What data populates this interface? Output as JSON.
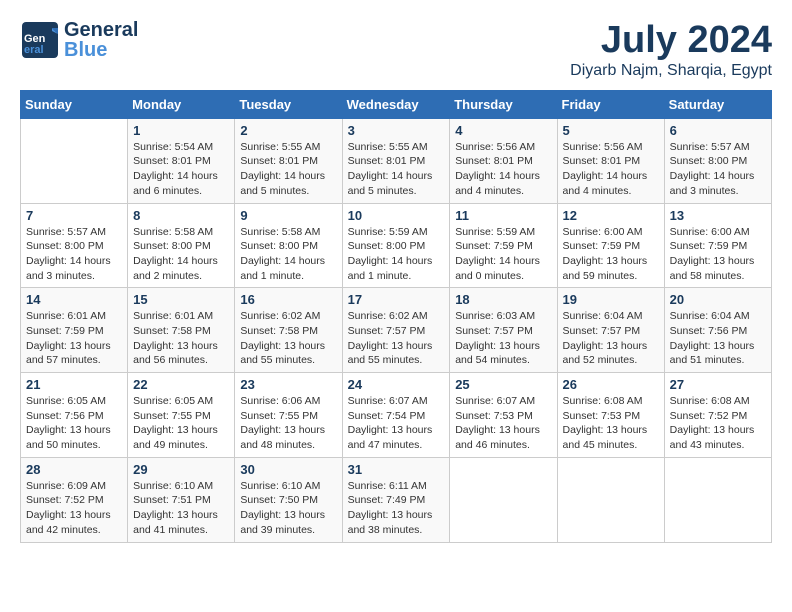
{
  "header": {
    "logo_general": "General",
    "logo_blue": "Blue",
    "month_year": "July 2024",
    "location": "Diyarb Najm, Sharqia, Egypt"
  },
  "calendar": {
    "days_of_week": [
      "Sunday",
      "Monday",
      "Tuesday",
      "Wednesday",
      "Thursday",
      "Friday",
      "Saturday"
    ],
    "weeks": [
      [
        {
          "day": "",
          "info": ""
        },
        {
          "day": "1",
          "info": "Sunrise: 5:54 AM\nSunset: 8:01 PM\nDaylight: 14 hours\nand 6 minutes."
        },
        {
          "day": "2",
          "info": "Sunrise: 5:55 AM\nSunset: 8:01 PM\nDaylight: 14 hours\nand 5 minutes."
        },
        {
          "day": "3",
          "info": "Sunrise: 5:55 AM\nSunset: 8:01 PM\nDaylight: 14 hours\nand 5 minutes."
        },
        {
          "day": "4",
          "info": "Sunrise: 5:56 AM\nSunset: 8:01 PM\nDaylight: 14 hours\nand 4 minutes."
        },
        {
          "day": "5",
          "info": "Sunrise: 5:56 AM\nSunset: 8:01 PM\nDaylight: 14 hours\nand 4 minutes."
        },
        {
          "day": "6",
          "info": "Sunrise: 5:57 AM\nSunset: 8:00 PM\nDaylight: 14 hours\nand 3 minutes."
        }
      ],
      [
        {
          "day": "7",
          "info": "Sunrise: 5:57 AM\nSunset: 8:00 PM\nDaylight: 14 hours\nand 3 minutes."
        },
        {
          "day": "8",
          "info": "Sunrise: 5:58 AM\nSunset: 8:00 PM\nDaylight: 14 hours\nand 2 minutes."
        },
        {
          "day": "9",
          "info": "Sunrise: 5:58 AM\nSunset: 8:00 PM\nDaylight: 14 hours\nand 1 minute."
        },
        {
          "day": "10",
          "info": "Sunrise: 5:59 AM\nSunset: 8:00 PM\nDaylight: 14 hours\nand 1 minute."
        },
        {
          "day": "11",
          "info": "Sunrise: 5:59 AM\nSunset: 7:59 PM\nDaylight: 14 hours\nand 0 minutes."
        },
        {
          "day": "12",
          "info": "Sunrise: 6:00 AM\nSunset: 7:59 PM\nDaylight: 13 hours\nand 59 minutes."
        },
        {
          "day": "13",
          "info": "Sunrise: 6:00 AM\nSunset: 7:59 PM\nDaylight: 13 hours\nand 58 minutes."
        }
      ],
      [
        {
          "day": "14",
          "info": "Sunrise: 6:01 AM\nSunset: 7:59 PM\nDaylight: 13 hours\nand 57 minutes."
        },
        {
          "day": "15",
          "info": "Sunrise: 6:01 AM\nSunset: 7:58 PM\nDaylight: 13 hours\nand 56 minutes."
        },
        {
          "day": "16",
          "info": "Sunrise: 6:02 AM\nSunset: 7:58 PM\nDaylight: 13 hours\nand 55 minutes."
        },
        {
          "day": "17",
          "info": "Sunrise: 6:02 AM\nSunset: 7:57 PM\nDaylight: 13 hours\nand 55 minutes."
        },
        {
          "day": "18",
          "info": "Sunrise: 6:03 AM\nSunset: 7:57 PM\nDaylight: 13 hours\nand 54 minutes."
        },
        {
          "day": "19",
          "info": "Sunrise: 6:04 AM\nSunset: 7:57 PM\nDaylight: 13 hours\nand 52 minutes."
        },
        {
          "day": "20",
          "info": "Sunrise: 6:04 AM\nSunset: 7:56 PM\nDaylight: 13 hours\nand 51 minutes."
        }
      ],
      [
        {
          "day": "21",
          "info": "Sunrise: 6:05 AM\nSunset: 7:56 PM\nDaylight: 13 hours\nand 50 minutes."
        },
        {
          "day": "22",
          "info": "Sunrise: 6:05 AM\nSunset: 7:55 PM\nDaylight: 13 hours\nand 49 minutes."
        },
        {
          "day": "23",
          "info": "Sunrise: 6:06 AM\nSunset: 7:55 PM\nDaylight: 13 hours\nand 48 minutes."
        },
        {
          "day": "24",
          "info": "Sunrise: 6:07 AM\nSunset: 7:54 PM\nDaylight: 13 hours\nand 47 minutes."
        },
        {
          "day": "25",
          "info": "Sunrise: 6:07 AM\nSunset: 7:53 PM\nDaylight: 13 hours\nand 46 minutes."
        },
        {
          "day": "26",
          "info": "Sunrise: 6:08 AM\nSunset: 7:53 PM\nDaylight: 13 hours\nand 45 minutes."
        },
        {
          "day": "27",
          "info": "Sunrise: 6:08 AM\nSunset: 7:52 PM\nDaylight: 13 hours\nand 43 minutes."
        }
      ],
      [
        {
          "day": "28",
          "info": "Sunrise: 6:09 AM\nSunset: 7:52 PM\nDaylight: 13 hours\nand 42 minutes."
        },
        {
          "day": "29",
          "info": "Sunrise: 6:10 AM\nSunset: 7:51 PM\nDaylight: 13 hours\nand 41 minutes."
        },
        {
          "day": "30",
          "info": "Sunrise: 6:10 AM\nSunset: 7:50 PM\nDaylight: 13 hours\nand 39 minutes."
        },
        {
          "day": "31",
          "info": "Sunrise: 6:11 AM\nSunset: 7:49 PM\nDaylight: 13 hours\nand 38 minutes."
        },
        {
          "day": "",
          "info": ""
        },
        {
          "day": "",
          "info": ""
        },
        {
          "day": "",
          "info": ""
        }
      ]
    ]
  }
}
